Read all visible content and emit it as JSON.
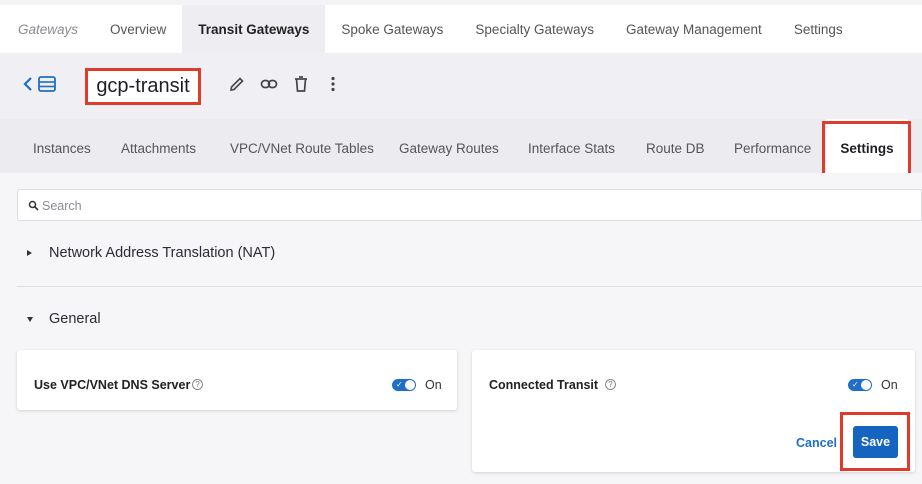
{
  "topnav": {
    "breadcrumb": "Gateways",
    "tabs": [
      "Overview",
      "Transit Gateways",
      "Spoke Gateways",
      "Specialty Gateways",
      "Gateway Management",
      "Settings"
    ],
    "active_tab": "Transit Gateways"
  },
  "header": {
    "title": "gcp-transit",
    "icons": [
      "back-chevron-icon",
      "list-icon",
      "edit-pencil-icon",
      "link-icon",
      "trash-icon",
      "more-vertical-icon"
    ]
  },
  "subtabs": {
    "items": [
      "Instances",
      "Attachments",
      "VPC/VNet Route Tables",
      "Gateway Routes",
      "Interface Stats",
      "Route DB",
      "Performance",
      "Settings"
    ],
    "active": "Settings"
  },
  "search": {
    "placeholder": "Search",
    "value": ""
  },
  "sections": {
    "nat": {
      "label": "Network Address Translation (NAT)",
      "expanded": false
    },
    "general": {
      "label": "General",
      "expanded": true
    }
  },
  "cards": {
    "dns": {
      "label": "Use VPC/VNet DNS Server",
      "help": "?",
      "toggle": "On"
    },
    "transit": {
      "label": "Connected Transit",
      "help": "?",
      "toggle": "On"
    }
  },
  "actions": {
    "cancel": "Cancel",
    "save": "Save"
  },
  "colors": {
    "accent": "#1565c0",
    "highlight": "#e03a2a"
  }
}
